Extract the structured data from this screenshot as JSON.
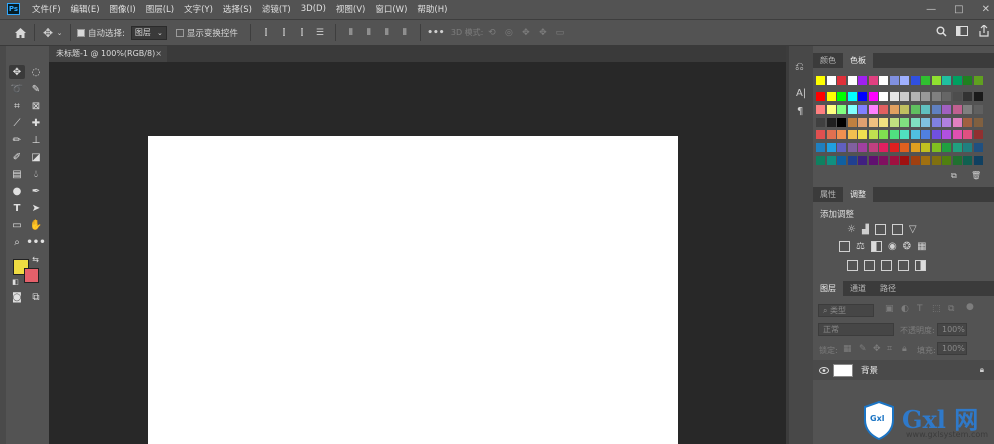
{
  "menubar": {
    "logo": "Ps",
    "items": [
      "文件(F)",
      "编辑(E)",
      "图像(I)",
      "图层(L)",
      "文字(Y)",
      "选择(S)",
      "滤镜(T)",
      "3D(D)",
      "视图(V)",
      "窗口(W)",
      "帮助(H)"
    ],
    "controls": [
      "—",
      "□",
      "✕"
    ]
  },
  "options": {
    "auto_select_label": "自动选择:",
    "layer_select_value": "图层",
    "transform_label": "显示变换控件",
    "mode_3d_label": "3D 模式:"
  },
  "document": {
    "tab_title": "未标题-1 @ 100%(RGB/8)",
    "close": "×"
  },
  "panels": {
    "top_tabs": [
      "颜色",
      "色板"
    ],
    "mid_tabs": [
      "属性",
      "调整"
    ],
    "adjustments_title": "添加调整",
    "layers_tabs": [
      "图层",
      "通道",
      "路径"
    ],
    "kind_placeholder": "类型",
    "blend_mode": "正常",
    "opacity_label": "不透明度:",
    "opacity_value": "100%",
    "lock_label": "锁定:",
    "fill_label": "填充:",
    "fill_value": "100%",
    "layer_name": "背景"
  },
  "colors": {
    "foreground": "#f0dc42",
    "background": "#e5606a"
  },
  "watermark": {
    "brand": "Gxl 网",
    "url": "www.gxlsystem.com",
    "badge": "Gxl"
  }
}
